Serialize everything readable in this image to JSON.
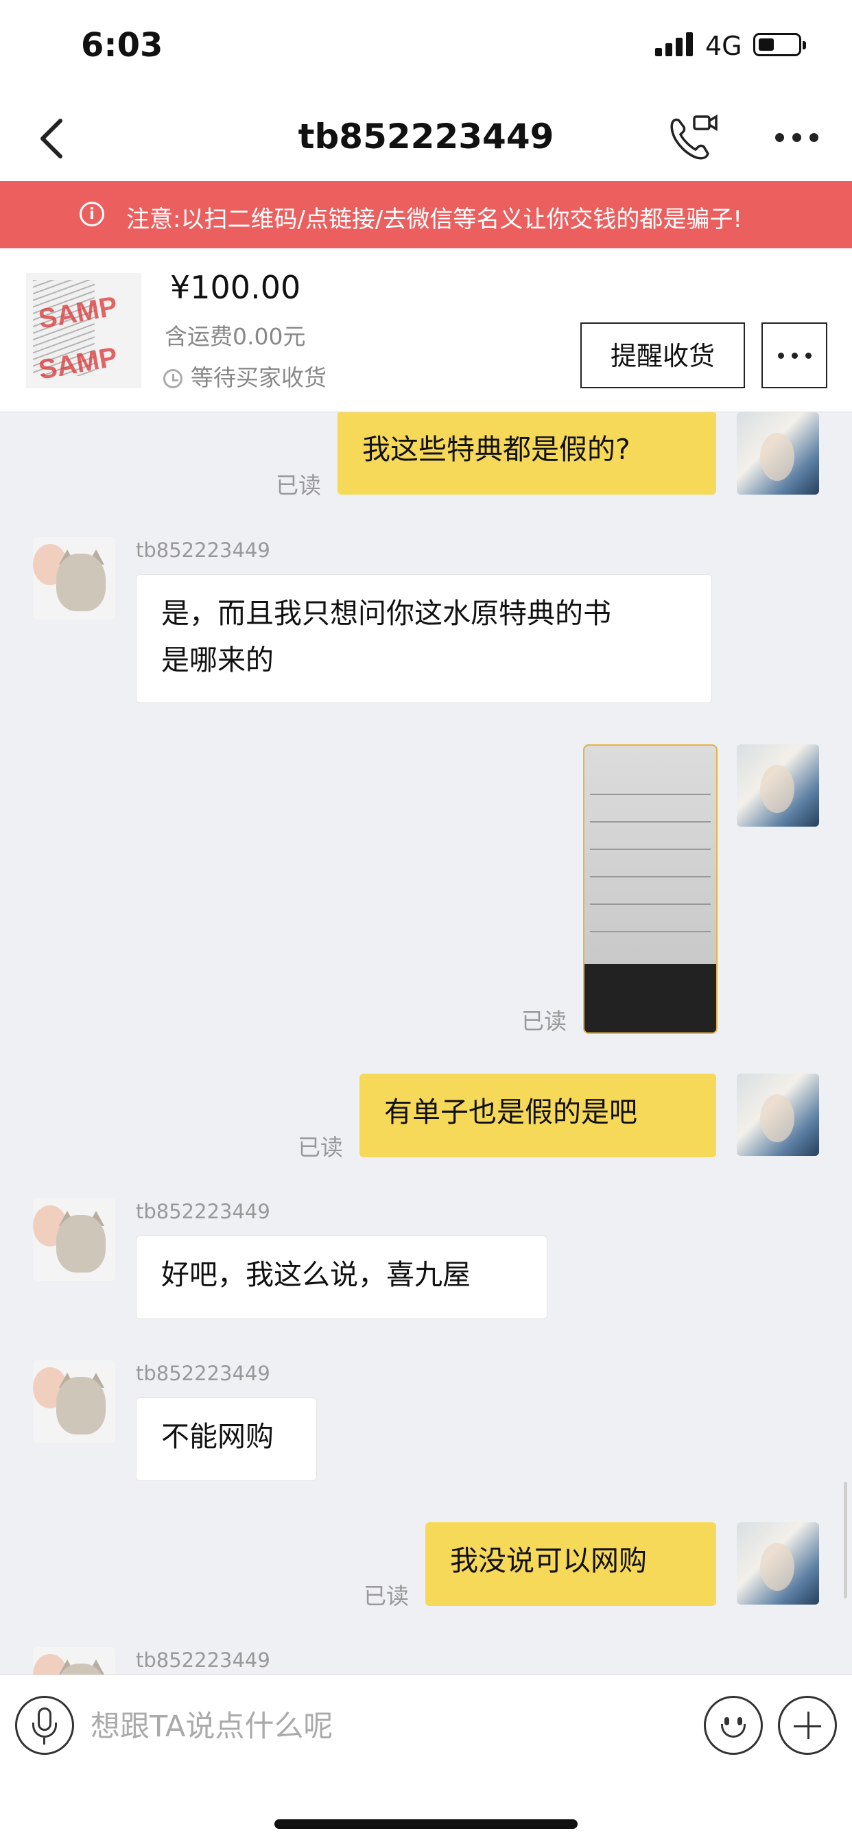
{
  "status_bar": {
    "time": "6:03",
    "network": "4G"
  },
  "nav": {
    "title": "tb852223449"
  },
  "notice": {
    "text": "注意:以扫二维码/点链接/去微信等名义让你交钱的都是骗子!"
  },
  "order": {
    "price": "¥100.00",
    "shipping": "含运费0.00元",
    "status": "等待买家收货",
    "remind_button": "提醒收货",
    "thumb_watermark": "SAMP"
  },
  "chat": {
    "partner_name": "tb852223449",
    "read_label": "已读",
    "messages": [
      {
        "side": "out",
        "type": "text",
        "text": "我这些特典都是假的?",
        "read": true
      },
      {
        "side": "in",
        "type": "text",
        "sender": "tb852223449",
        "lines": [
          "是，而且我只想问你这水原特典的书",
          "是哪来的"
        ]
      },
      {
        "side": "out",
        "type": "image",
        "read": true
      },
      {
        "side": "out",
        "type": "text",
        "text": "有单子也是假的是吧",
        "read": true
      },
      {
        "side": "in",
        "type": "text",
        "sender": "tb852223449",
        "text": "好吧，我这么说，喜九屋"
      },
      {
        "side": "in",
        "type": "text",
        "sender": "tb852223449",
        "text": "不能网购"
      },
      {
        "side": "out",
        "type": "text",
        "text": "我没说可以网购",
        "read": true
      },
      {
        "side": "in",
        "type": "partial",
        "sender": "tb852223449"
      }
    ]
  },
  "input": {
    "placeholder": "想跟TA说点什么呢"
  },
  "icons": {
    "back": "back-arrow-icon",
    "call": "phone-video-icon",
    "more": "more-dots-icon",
    "info": "info-icon",
    "clock": "clock-icon",
    "mic": "microphone-icon",
    "emoji": "emoji-icon",
    "plus": "plus-icon"
  },
  "colors": {
    "notice_bg": "#ec5f5f",
    "outgoing_bubble": "#f7d95a",
    "incoming_bubble": "#ffffff",
    "chat_bg": "#eef0f4"
  }
}
